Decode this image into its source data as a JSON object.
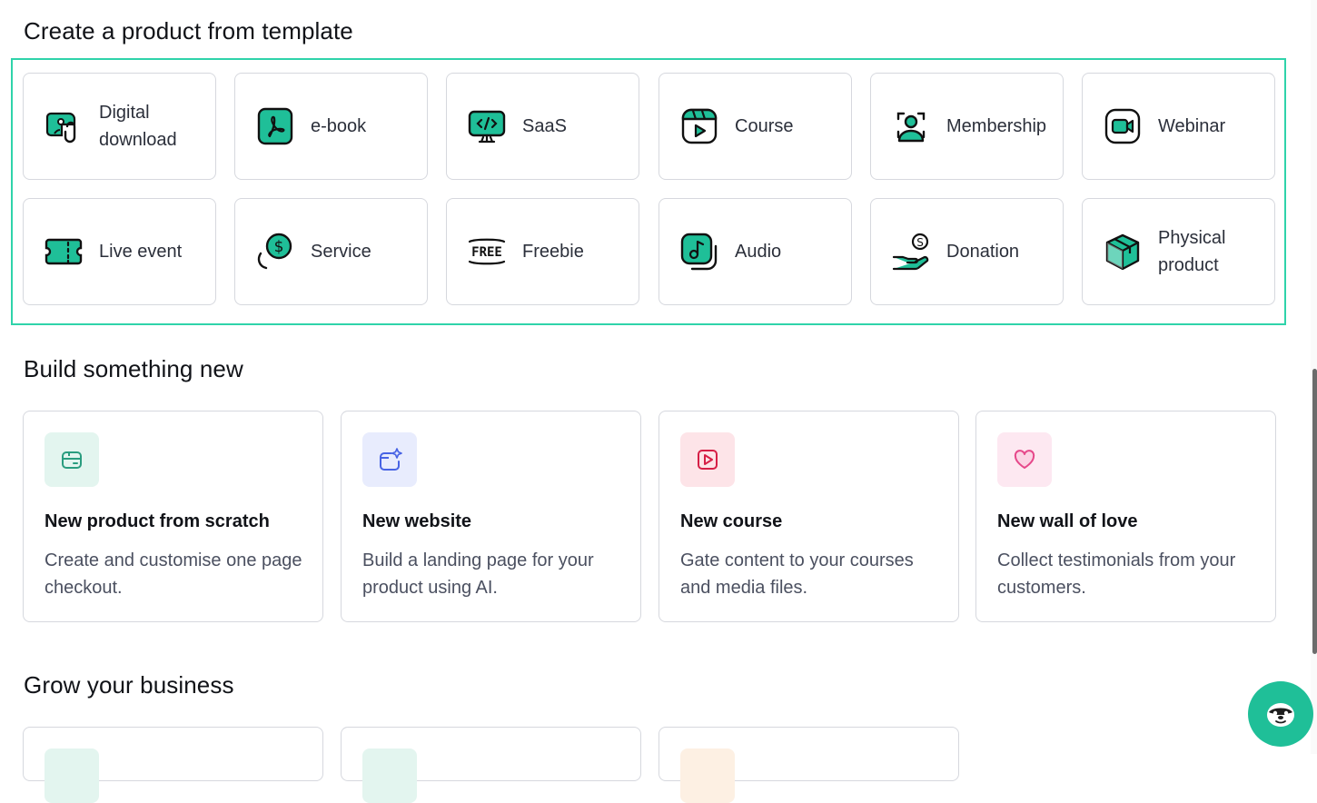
{
  "sections": {
    "templates_title": "Create a product from template",
    "build_title": "Build something new",
    "grow_title": "Grow your business"
  },
  "templates": [
    {
      "label": "Digital download",
      "icon": "digital-download-icon"
    },
    {
      "label": "e-book",
      "icon": "ebook-pdf-icon"
    },
    {
      "label": "SaaS",
      "icon": "saas-monitor-icon"
    },
    {
      "label": "Course",
      "icon": "course-video-icon"
    },
    {
      "label": "Membership",
      "icon": "membership-user-icon"
    },
    {
      "label": "Webinar",
      "icon": "webinar-camera-icon"
    },
    {
      "label": "Live event",
      "icon": "ticket-icon"
    },
    {
      "label": "Service",
      "icon": "service-dollar-icon"
    },
    {
      "label": "Freebie",
      "icon": "free-tag-icon"
    },
    {
      "label": "Audio",
      "icon": "audio-note-icon"
    },
    {
      "label": "Donation",
      "icon": "donation-hand-icon"
    },
    {
      "label": "Physical product",
      "icon": "box-icon"
    }
  ],
  "build": [
    {
      "title": "New product from scratch",
      "desc": "Create and customise one page checkout.",
      "icon": "product-box-icon",
      "bg": "#e3f5ef",
      "fg": "#2a9d7f"
    },
    {
      "title": "New website",
      "desc": "Build a landing page for your product using AI.",
      "icon": "website-sparkle-icon",
      "bg": "#e8ecfd",
      "fg": "#4763e4"
    },
    {
      "title": "New course",
      "desc": "Gate content to your courses and media files.",
      "icon": "play-icon",
      "bg": "#fde4e8",
      "fg": "#d61f46"
    },
    {
      "title": "New wall of love",
      "desc": "Collect testimonials from your customers.",
      "icon": "heart-icon",
      "bg": "#fde8f1",
      "fg": "#e6478a"
    }
  ],
  "colors": {
    "accent": "#2fd3aa",
    "icon_fill": "#1fbf98",
    "chat": "#1fbf98"
  }
}
